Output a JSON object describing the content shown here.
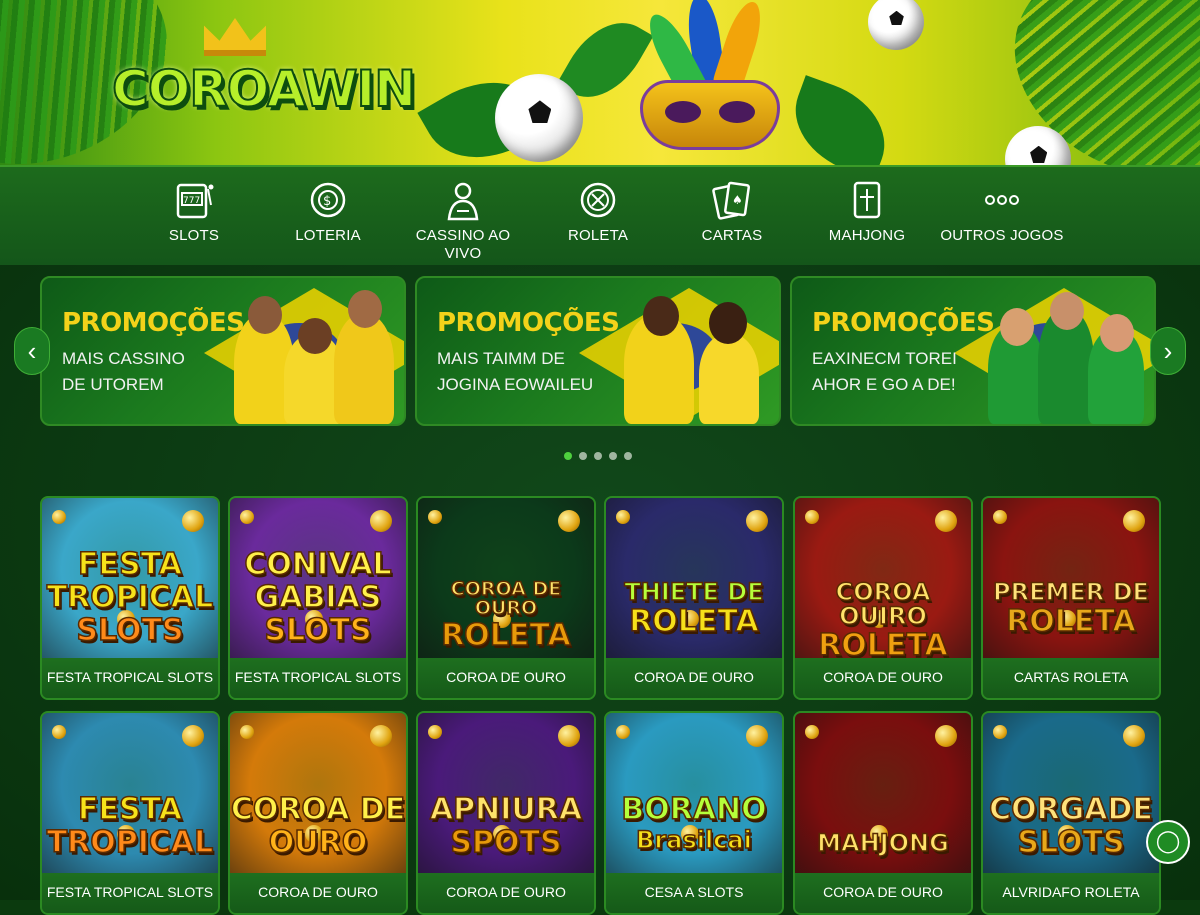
{
  "brand": {
    "logo_text": "COROAWIN"
  },
  "nav": [
    {
      "label": "SLOTS",
      "icon": "slot-machine-icon"
    },
    {
      "label": "LOTERIA",
      "icon": "lottery-ball-icon"
    },
    {
      "label": "CASSINO AO VIVO",
      "icon": "live-dealer-icon"
    },
    {
      "label": "ROLETA",
      "icon": "roulette-icon"
    },
    {
      "label": "CARTAS",
      "icon": "playing-cards-icon"
    },
    {
      "label": "MAHJONG",
      "icon": "mahjong-tile-icon"
    },
    {
      "label": "OUTROS JOGOS",
      "icon": "more-dots-icon"
    }
  ],
  "promos": [
    {
      "title": "PROMOÇÕES",
      "line1": "MAIS CASSINO",
      "line2": "DE UTOREM"
    },
    {
      "title": "PROMOÇÕES",
      "line1": "MAIS TAIMM DE",
      "line2": "JOGINA EOWAILEU"
    },
    {
      "title": "PROMOÇÕES",
      "line1": "EAXINECM TOREI",
      "line2": "AHOR E GO A DE!"
    }
  ],
  "carousel": {
    "prev": "‹",
    "next": "›",
    "active_dot": 0,
    "dot_count": 5
  },
  "games_row1": [
    {
      "art_lines": [
        "FESTA",
        "TROPICAL",
        "SLOTS"
      ],
      "caption": "FESTA TROPICAL SLOTS",
      "theme": "#3aa7c9"
    },
    {
      "art_lines": [
        "CONIVAL",
        "GABIAS",
        "SLOTS"
      ],
      "caption": "FESTA TROPICAL SLOTS",
      "theme": "#6a2a9c"
    },
    {
      "art_lines": [
        "COROA DE OURO",
        "ROLETA"
      ],
      "caption": "COROA DE OURO ROLETA",
      "theme": "#0c3a1a"
    },
    {
      "art_lines": [
        "THIETE DE",
        "ROLETA"
      ],
      "caption": "COROA DE OURO ROLETA",
      "theme": "#2a2a6a"
    },
    {
      "art_lines": [
        "COROA OUIRO",
        "ROLETA"
      ],
      "caption": "COROA DE OURO ROLETA",
      "theme": "#9a1a12"
    },
    {
      "art_lines": [
        "PREMER DE",
        "ROLETA"
      ],
      "caption": "CARTAS ROLETA",
      "theme": "#8a1410"
    }
  ],
  "games_row2": [
    {
      "art_lines": [
        "FESTA",
        "TROPICAL"
      ],
      "caption": "FESTA TROPICAL SLOTS",
      "theme": "#2d8ab0"
    },
    {
      "art_lines": [
        "COROA DE",
        "OURO"
      ],
      "caption": "COROA DE OURO ROLETA",
      "theme": "#d47a0a"
    },
    {
      "art_lines": [
        "APNIURA",
        "SPOTS"
      ],
      "caption": "COROA DE OURO ROLETA",
      "theme": "#4a1a7a"
    },
    {
      "art_lines": [
        "BORANO",
        "Brasilcai"
      ],
      "caption": "CESA A SLOTS",
      "theme": "#2a9ac0"
    },
    {
      "art_lines": [
        "MAHJONG"
      ],
      "caption": "COROA DE OURO ROLETA",
      "theme": "#7a0e0e"
    },
    {
      "art_lines": [
        "CORGADE",
        "SLOTS"
      ],
      "caption": "ALVRIDAFO ROLETA",
      "theme": "#1a6a8a"
    }
  ],
  "colors": {
    "accent_green": "#4ed03e",
    "promo_gold": "#f3d21a",
    "nav_bg": "#1d6b1c"
  }
}
